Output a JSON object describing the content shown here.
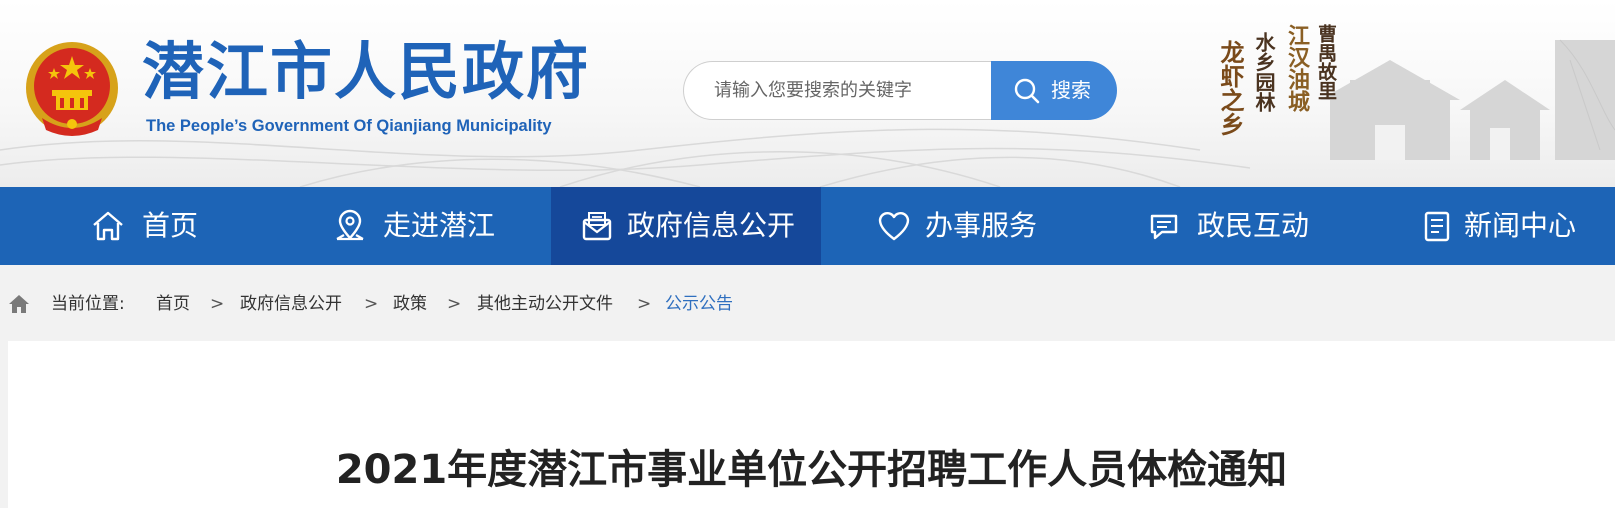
{
  "header": {
    "title": "潜江市人民政府",
    "subtitle": "The People’s Government Of Qianjiang Municipality",
    "slogans": [
      "龙虾之乡",
      "水乡园林",
      "江汉油城",
      "曹禺故里"
    ]
  },
  "search": {
    "placeholder": "请输入您要搜索的关键字",
    "button_label": "搜索"
  },
  "nav": {
    "items": [
      {
        "label": "首页",
        "icon": "home-icon"
      },
      {
        "label": "走进潜江",
        "icon": "location-icon"
      },
      {
        "label": "政府信息公开",
        "icon": "mail-icon",
        "active": true
      },
      {
        "label": "办事服务",
        "icon": "heart-icon"
      },
      {
        "label": "政民互动",
        "icon": "chat-icon"
      },
      {
        "label": "新闻中心",
        "icon": "news-icon"
      }
    ]
  },
  "breadcrumb": {
    "prefix": "当前位置:",
    "items": [
      "首页",
      "政府信息公开",
      "政策",
      "其他主动公开文件",
      "公示公告"
    ],
    "separator": ">"
  },
  "article": {
    "title": "2021年度潜江市事业单位公开招聘工作人员体检通知"
  },
  "colors": {
    "brand_blue": "#1d64b6",
    "nav_active": "#15489a",
    "search_button": "#3f86d8",
    "breadcrumb_current": "#2f6fbf"
  }
}
